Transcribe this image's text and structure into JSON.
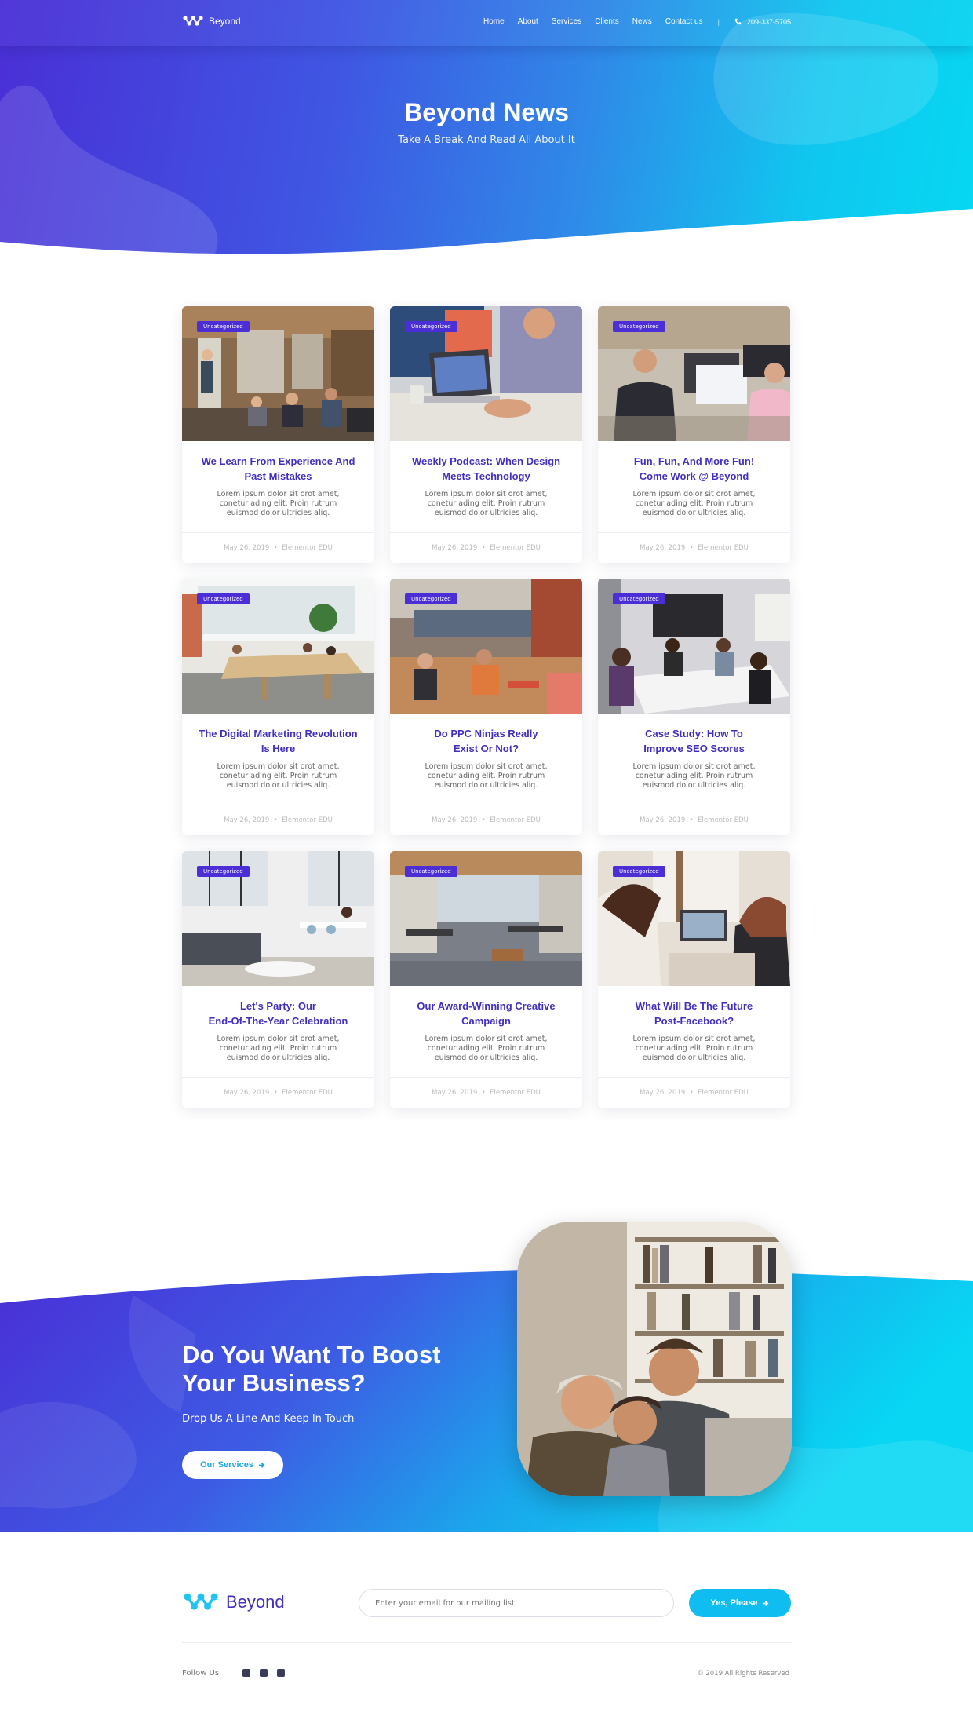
{
  "header": {
    "logo_text": "Beyond",
    "nav": [
      "Home",
      "About",
      "Services",
      "Clients",
      "News",
      "Contact us"
    ],
    "separator": "|",
    "phone": "209-337-5705"
  },
  "hero": {
    "title": "Beyond News",
    "subtitle": "Take A Break And Read All About It"
  },
  "posts": [
    {
      "category": "Uncategorized",
      "title_line1": "We Learn From Experience And",
      "title_line2": "Past Mistakes",
      "excerpt": "Lorem ipsum dolor sit orot amet, conetur ading elit. Proin rutrum euismod dolor ultricies aliq.",
      "date": "May 26, 2019",
      "author": "Elementor EDU"
    },
    {
      "category": "Uncategorized",
      "title_line1": "Weekly Podcast: When Design",
      "title_line2": "Meets Technology",
      "excerpt": "Lorem ipsum dolor sit orot amet, conetur ading elit. Proin rutrum euismod dolor ultricies aliq.",
      "date": "May 26, 2019",
      "author": "Elementor EDU"
    },
    {
      "category": "Uncategorized",
      "title_line1": "Fun, Fun, And More Fun!",
      "title_line2": "Come Work @ Beyond",
      "excerpt": "Lorem ipsum dolor sit orot amet, conetur ading elit. Proin rutrum euismod dolor ultricies aliq.",
      "date": "May 26, 2019",
      "author": "Elementor EDU"
    },
    {
      "category": "Uncategorized",
      "title_line1": "The Digital Marketing Revolution",
      "title_line2": "Is Here",
      "excerpt": "Lorem ipsum dolor sit orot amet, conetur ading elit. Proin rutrum euismod dolor ultricies aliq.",
      "date": "May 26, 2019",
      "author": "Elementor EDU"
    },
    {
      "category": "Uncategorized",
      "title_line1": "Do PPC Ninjas Really",
      "title_line2": "Exist Or Not?",
      "excerpt": "Lorem ipsum dolor sit orot amet, conetur ading elit. Proin rutrum euismod dolor ultricies aliq.",
      "date": "May 26, 2019",
      "author": "Elementor EDU"
    },
    {
      "category": "Uncategorized",
      "title_line1": "Case Study: How To",
      "title_line2": "Improve SEO Scores",
      "excerpt": "Lorem ipsum dolor sit orot amet, conetur ading elit. Proin rutrum euismod dolor ultricies aliq.",
      "date": "May 26, 2019",
      "author": "Elementor EDU"
    },
    {
      "category": "Uncategorized",
      "title_line1": "Let's Party: Our",
      "title_line2": "End-Of-The-Year Celebration",
      "excerpt": "Lorem ipsum dolor sit orot amet, conetur ading elit. Proin rutrum euismod dolor ultricies aliq.",
      "date": "May 26, 2019",
      "author": "Elementor EDU"
    },
    {
      "category": "Uncategorized",
      "title_line1": "Our Award-Winning Creative",
      "title_line2": "Campaign",
      "excerpt": "Lorem ipsum dolor sit orot amet, conetur ading elit. Proin rutrum euismod dolor ultricies aliq.",
      "date": "May 26, 2019",
      "author": "Elementor EDU"
    },
    {
      "category": "Uncategorized",
      "title_line1": "What Will Be The Future",
      "title_line2": "Post-Facebook?",
      "excerpt": "Lorem ipsum dolor sit orot amet, conetur ading elit. Proin rutrum euismod dolor ultricies aliq.",
      "date": "May 26, 2019",
      "author": "Elementor EDU"
    }
  ],
  "cta": {
    "title_line1": "Do You Want To Boost",
    "title_line2": "Your Business?",
    "subtitle": "Drop Us A Line And Keep In Touch",
    "button": "Our Services"
  },
  "footer": {
    "logo_text": "Beyond",
    "email_placeholder": "Enter your email for our mailing list",
    "subscribe_button": "Yes, Please",
    "follow_label": "Follow Us",
    "social": [
      "facebook-icon",
      "twitter-icon",
      "linkedin-icon"
    ],
    "copyright": "© 2019 All Rights Reserved"
  },
  "colors": {
    "brand_purple": "#4b2ed6",
    "brand_cyan": "#06d8f2",
    "title_purple": "#4130bf",
    "button_cyan": "#10bdf0"
  }
}
